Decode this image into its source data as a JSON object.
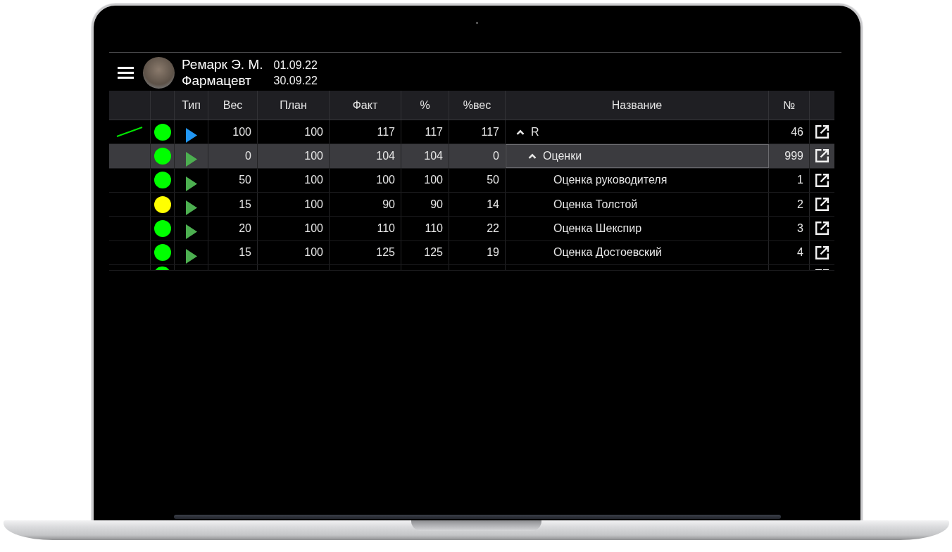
{
  "header": {
    "user": {
      "name": "Ремарк Э. М.",
      "role": "Фармацевт"
    },
    "period": {
      "start": "01.09.22",
      "end": "30.09.22"
    }
  },
  "table": {
    "columns": [
      "Тип",
      "Вес",
      "План",
      "Факт",
      "%",
      "%вес",
      "Название",
      "№"
    ],
    "rows": [
      {
        "kind": "row",
        "selected": false,
        "trend": true,
        "status": {
          "color": "#00ff00"
        },
        "type": {
          "color": "#2196f3"
        },
        "weight": "100",
        "plan": "100",
        "fact": "117",
        "percent": "117",
        "weighted_percent": "117",
        "name": "R",
        "expanded": true,
        "number": "46",
        "children": [
          {
            "kind": "row",
            "selected": true,
            "trend": false,
            "status": {
              "color": "#00ff00"
            },
            "type": {
              "color": "#4caf50"
            },
            "weight": "0",
            "plan": "100",
            "fact": "104",
            "percent": "104",
            "weighted_percent": "0",
            "name": "Оценки",
            "expanded": true,
            "number": "999",
            "children": [
              {
                "kind": "row",
                "selected": false,
                "trend": false,
                "status": {
                  "color": "#00ff00"
                },
                "type": {
                  "color": "#4caf50"
                },
                "weight": "50",
                "plan": "100",
                "fact": "100",
                "percent": "100",
                "weighted_percent": "50",
                "name": "Оценка руководителя",
                "number": "1"
              },
              {
                "kind": "row",
                "selected": false,
                "trend": false,
                "status": {
                  "color": "#ffff00"
                },
                "type": {
                  "color": "#4caf50"
                },
                "weight": "15",
                "plan": "100",
                "fact": "90",
                "percent": "90",
                "weighted_percent": "14",
                "name": "Оценка Толстой",
                "number": "2"
              },
              {
                "kind": "row",
                "selected": false,
                "trend": false,
                "status": {
                  "color": "#00ff00"
                },
                "type": {
                  "color": "#4caf50"
                },
                "weight": "20",
                "plan": "100",
                "fact": "110",
                "percent": "110",
                "weighted_percent": "22",
                "name": "Оценка Шекспир",
                "number": "3"
              },
              {
                "kind": "row",
                "selected": false,
                "trend": false,
                "status": {
                  "color": "#00ff00"
                },
                "type": {
                  "color": "#4caf50"
                },
                "weight": "15",
                "plan": "100",
                "fact": "125",
                "percent": "125",
                "weighted_percent": "19",
                "name": "Оценка Достоевский",
                "number": "4"
              },
              {
                "kind": "partial",
                "selected": false,
                "status": {
                  "color": "#00ff00"
                }
              }
            ]
          }
        ]
      }
    ]
  }
}
